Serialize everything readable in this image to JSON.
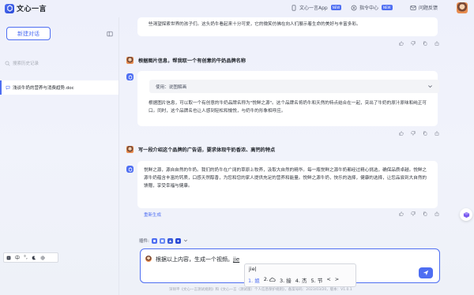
{
  "app": {
    "name": "文心一言"
  },
  "topbar": {
    "links": [
      {
        "label": "文心一言App",
        "badge": "NEW"
      },
      {
        "label": "指令中心",
        "badge": "NEW"
      },
      {
        "label": "问题反馈"
      }
    ]
  },
  "sidebar": {
    "new_chat": "新建对话",
    "search_placeholder": "搜索历史记录",
    "history": [
      {
        "label": "浅谈牛奶的营养与消费趋势.doc"
      }
    ]
  },
  "conversation": {
    "prev_fragment": "些渴望探索世界的孩子们。这头奶牛看起来十分可爱，它的微笑仿佛在向人们展示着生命的美好与丰富多彩。",
    "q1": "根据图片信息，帮我取一个有创意的牛奶品牌名称",
    "a1_plugin": "使用：说图解画",
    "a1_text": "根据图片信息，可以取一个有创意的牛奶品牌名称为\"悦鲜之源\"。这个品牌名将奶牛和天然的特点结合在一起，突出了牛奶的原汁原味和纯正可口。同时，这个品牌名也让人感到轻松和愉悦，与奶牛的形象相呼应。",
    "q2": "写一段介绍这个品牌的广告语，要求体现牛奶香浓、高钙的特点",
    "a2_text": "悦鲜之源，源自自然的牛奶。我们的奶牛在广阔的草原上牧养，汲取大自然的精华。每一瓶悦鲜之源牛奶都经过精心挑选，确保品质卓越。悦鲜之源牛奶蕴含丰富的钙质，口感天然醇香，为您和您的家人提供充足的营养和能量。悦鲜之源牛奶，快乐的选择，健康的选择，让您品尝到大自然的馈赠，享受幸福与健康。",
    "regenerate": "重新生成"
  },
  "input": {
    "plugin_label": "插件:",
    "text": "根据以上内容，生成一个视频。",
    "composing": "jie"
  },
  "ime": {
    "composition": "jie|",
    "candidates": [
      "1. 姐",
      "2.",
      "3. 接",
      "4. 杰",
      "5. 节",
      "<",
      ">"
    ],
    "toolbar": [
      "中",
      "°,"
    ]
  },
  "footer": "深圳平《文心一言测试规则》和《文心一言（测试版）个人信息保护规则》，备案号码：2023/03/20，版本：V1.0.1",
  "colors": {
    "accent": "#4e6ef2",
    "bg": "#eef0fb"
  }
}
